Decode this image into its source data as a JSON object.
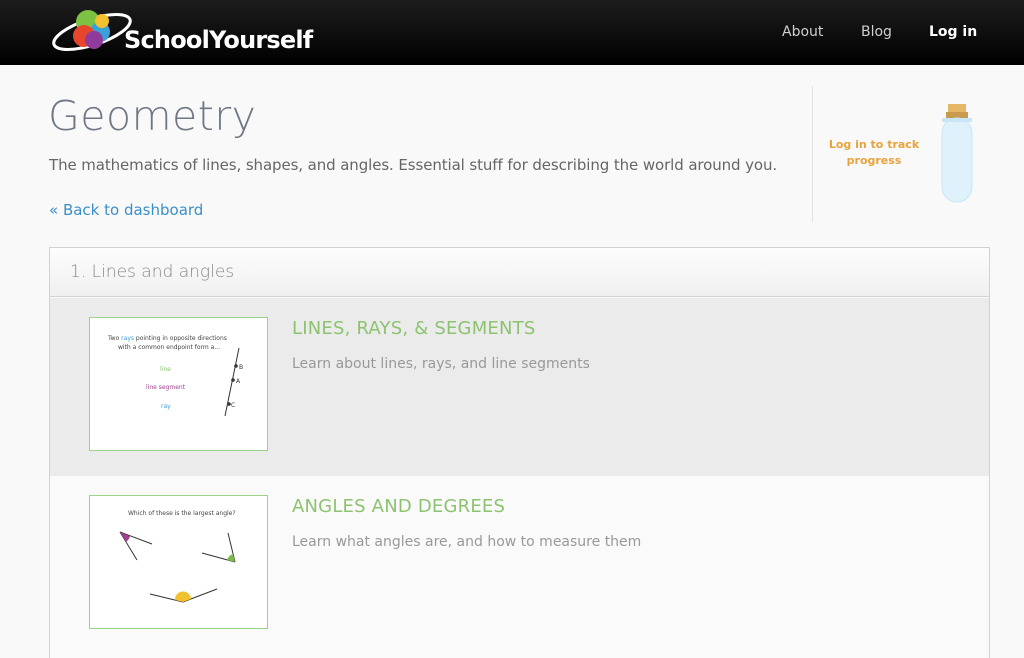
{
  "header": {
    "logo_text": "SchoolYourself",
    "nav": {
      "about": "About",
      "blog": "Blog",
      "login": "Log in"
    }
  },
  "page": {
    "title": "Geometry",
    "subtitle": "The mathematics of lines, shapes, and angles. Essential stuff for describing the world around you.",
    "back_link": "« Back to dashboard"
  },
  "progress": {
    "track_text": "Log in to track progress"
  },
  "section": {
    "title": "1. Lines and angles",
    "lessons": [
      {
        "title": "LINES, RAYS, & SEGMENTS",
        "description": "Learn about lines, rays, and line segments",
        "thumb": {
          "prompt_line1_a": "Two ",
          "prompt_line1_b": "rays",
          "prompt_line1_c": " pointing in opposite directions",
          "prompt_line2": "with a common endpoint form a...",
          "option_line": "line",
          "option_segment": "line segment",
          "option_ray": "ray",
          "point_b": "B",
          "point_a": "A",
          "point_c": "C"
        }
      },
      {
        "title": "ANGLES AND DEGREES",
        "description": "Learn what angles are, and how to measure them",
        "thumb": {
          "prompt": "Which of these is the largest angle?"
        }
      }
    ]
  },
  "colors": {
    "accent_green": "#8cc36f",
    "link_blue": "#3a8fc9",
    "track_orange": "#e8a33a"
  }
}
